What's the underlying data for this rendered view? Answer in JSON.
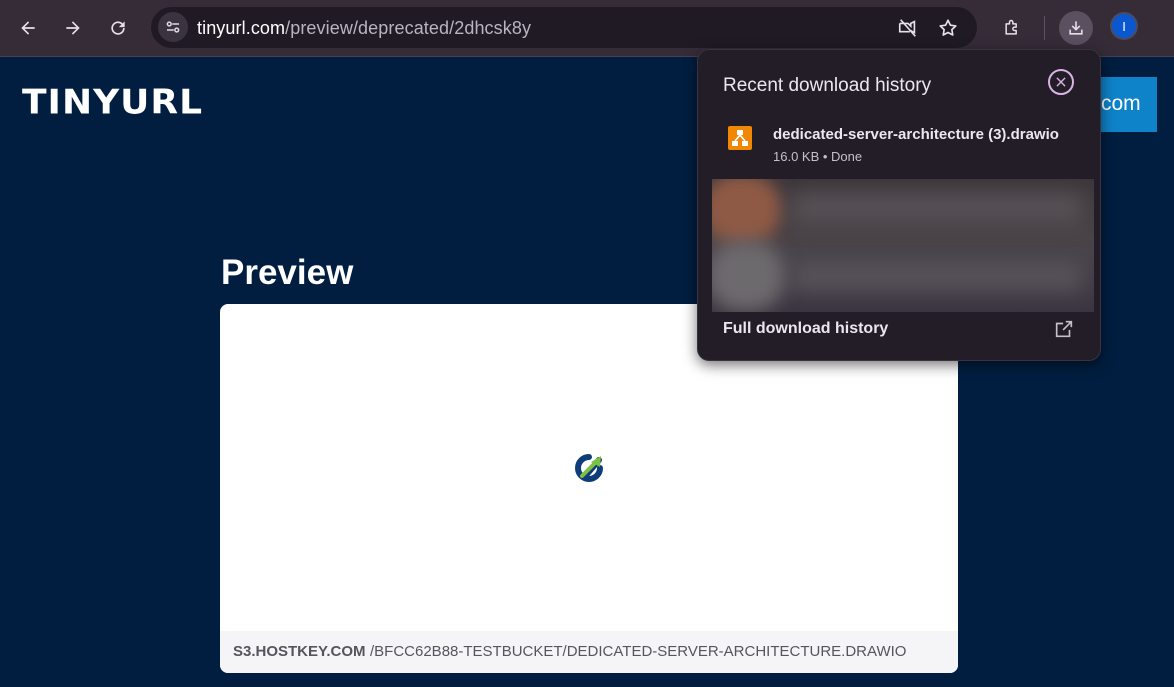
{
  "browser": {
    "url_host": "tinyurl.com",
    "url_path": "/preview/deprecated/2dhcsk8y",
    "profile_initial": "I",
    "icons": {
      "back": "arrow-left-icon",
      "forward": "arrow-right-icon",
      "reload": "reload-icon",
      "site_info": "tune-icon",
      "camera_blocked": "camera-off-icon",
      "bookmark": "star-icon",
      "extensions": "puzzle-icon",
      "downloads": "download-icon"
    }
  },
  "page": {
    "logo": "TINYURL",
    "cta_label": "com",
    "preview_title": "Preview",
    "footer_host": "S3.HOSTKEY.COM",
    "footer_path": "/BFCC62B88-TESTBUCKET/DEDICATED-SERVER-ARCHITECTURE.DRAWIO"
  },
  "downloads": {
    "title": "Recent download history",
    "items": [
      {
        "name": "dedicated-server-architecture (3).drawio",
        "meta": "16.0 KB • Done",
        "icon": "drawio-icon"
      }
    ],
    "full_history_label": "Full download history"
  },
  "colors": {
    "page_bg": "#011e40",
    "cta_bg": "#0f83c9",
    "bubble_bg": "#231d27",
    "drawio_orange": "#f08705"
  }
}
